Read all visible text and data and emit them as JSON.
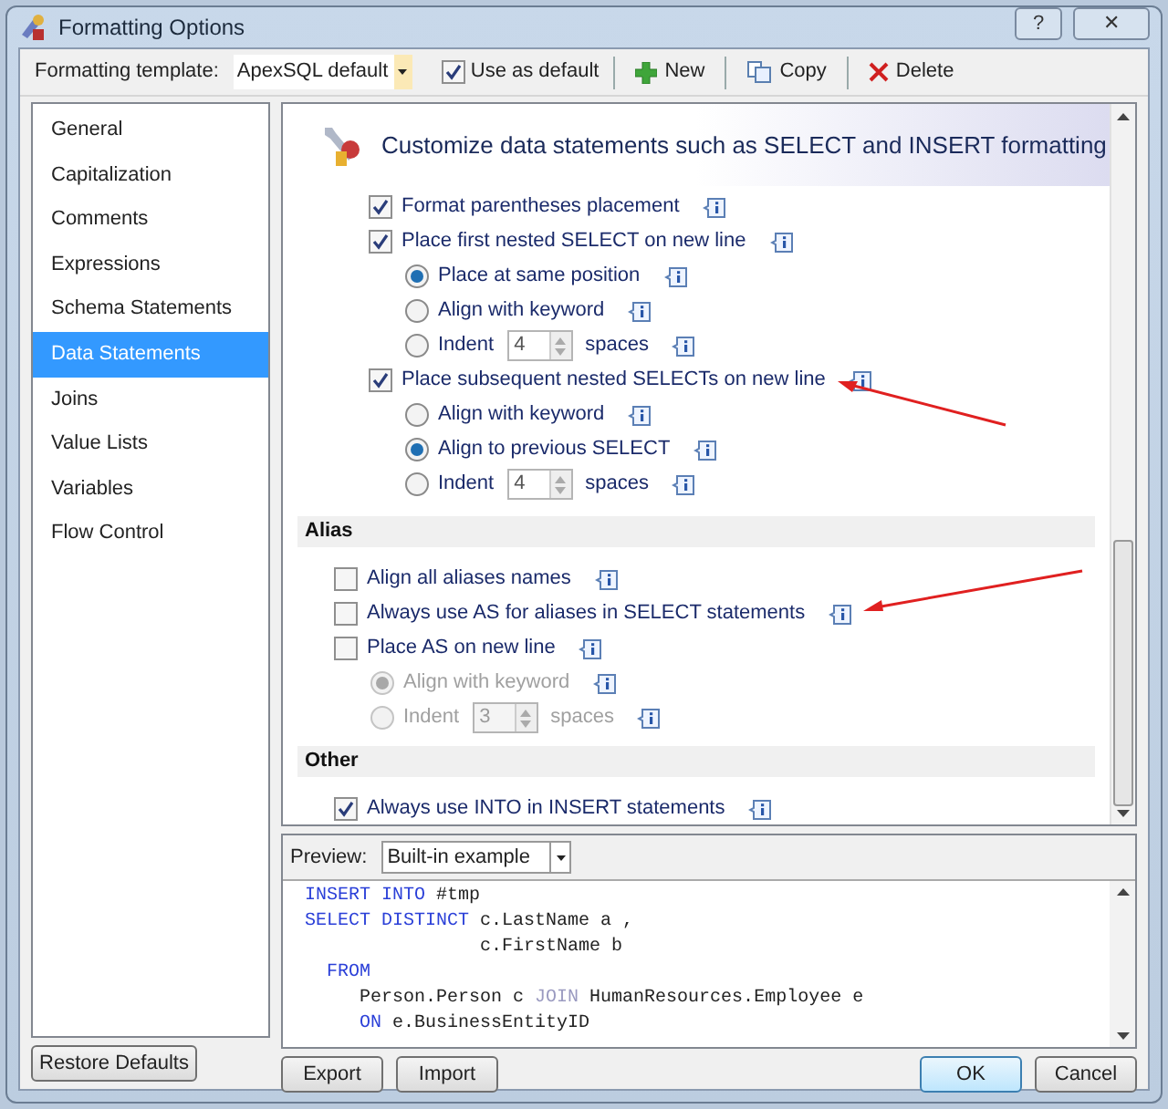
{
  "window": {
    "title": "Formatting Options",
    "help": "?",
    "close": "✕"
  },
  "toolbar": {
    "template_label": "Formatting template:",
    "template_value": "ApexSQL default",
    "use_as_default": {
      "label": "Use as default",
      "checked": true
    },
    "buttons": [
      {
        "kind": "new",
        "label": "New"
      },
      {
        "kind": "copy",
        "label": "Copy"
      },
      {
        "kind": "delete",
        "label": "Delete"
      }
    ]
  },
  "sidebar": {
    "items": [
      {
        "label": "General",
        "selected": false
      },
      {
        "label": "Capitalization",
        "selected": false
      },
      {
        "label": "Comments",
        "selected": false
      },
      {
        "label": "Expressions",
        "selected": false
      },
      {
        "label": "Schema Statements",
        "selected": false
      },
      {
        "label": "Data Statements",
        "selected": true
      },
      {
        "label": "Joins",
        "selected": false
      },
      {
        "label": "Value Lists",
        "selected": false
      },
      {
        "label": "Variables",
        "selected": false
      },
      {
        "label": "Flow Control",
        "selected": false
      }
    ]
  },
  "panel": {
    "heading": "Customize data statements such as SELECT and INSERT formatting",
    "sections": [
      {
        "options": [
          {
            "kind": "checkbox",
            "label": "Format parentheses placement",
            "checked": true,
            "disabled": false
          },
          {
            "kind": "checkbox",
            "label": "Place first nested SELECT on new line",
            "checked": true,
            "disabled": false,
            "children": [
              {
                "kind": "radio",
                "label": "Place at same position",
                "selected": true,
                "disabled": false
              },
              {
                "kind": "radio",
                "label": "Align with keyword",
                "selected": false,
                "disabled": false
              },
              {
                "kind": "spin",
                "label": "Indent",
                "value": "4",
                "suffix": "spaces",
                "selected": false,
                "disabled": false
              }
            ]
          },
          {
            "kind": "checkbox",
            "label": "Place subsequent nested SELECTs on new line",
            "checked": true,
            "disabled": false,
            "children": [
              {
                "kind": "radio",
                "label": "Align with keyword",
                "selected": false,
                "disabled": false
              },
              {
                "kind": "radio",
                "label": "Align to previous SELECT",
                "selected": true,
                "disabled": false
              },
              {
                "kind": "spin",
                "label": "Indent",
                "value": "4",
                "suffix": "spaces",
                "selected": false,
                "disabled": false
              }
            ]
          }
        ]
      },
      {
        "title": "Alias",
        "options": [
          {
            "kind": "checkbox",
            "label": "Align all aliases names",
            "checked": false,
            "disabled": false
          },
          {
            "kind": "checkbox",
            "label": "Always use AS for aliases in SELECT statements",
            "checked": false,
            "disabled": false
          },
          {
            "kind": "checkbox",
            "label": "Place AS on new line",
            "checked": false,
            "disabled": false,
            "children": [
              {
                "kind": "radio",
                "label": "Align with keyword",
                "selected": true,
                "disabled": true
              },
              {
                "kind": "spin",
                "label": "Indent",
                "value": "3",
                "suffix": "spaces",
                "selected": false,
                "disabled": true
              }
            ]
          }
        ]
      },
      {
        "title": "Other",
        "options": [
          {
            "kind": "checkbox",
            "label": "Always use INTO in INSERT statements",
            "checked": true,
            "disabled": false
          }
        ]
      }
    ]
  },
  "preview": {
    "label": "Preview:",
    "value": "Built-in example",
    "lines": [
      [
        {
          "kind": "keyword",
          "text": "INSERT INTO"
        },
        {
          "kind": "text",
          "text": " #tmp"
        }
      ],
      [
        {
          "kind": "keyword",
          "text": "SELECT DISTINCT"
        },
        {
          "kind": "text",
          "text": " c.LastName a ,"
        }
      ],
      [
        {
          "kind": "text",
          "text": "                c.FirstName b"
        }
      ],
      [
        {
          "kind": "keyword",
          "text": "  FROM"
        }
      ],
      [
        {
          "kind": "text",
          "text": "     Person.Person c "
        },
        {
          "kind": "muted",
          "text": "JOIN"
        },
        {
          "kind": "text",
          "text": " HumanResources.Employee e"
        }
      ],
      [
        {
          "kind": "keyword",
          "text": "     ON"
        },
        {
          "kind": "text",
          "text": " e.BusinessEntityID"
        }
      ]
    ]
  },
  "footer": {
    "restore": "Restore Defaults",
    "export": "Export",
    "import": "Import",
    "ok": "OK",
    "cancel": "Cancel"
  }
}
